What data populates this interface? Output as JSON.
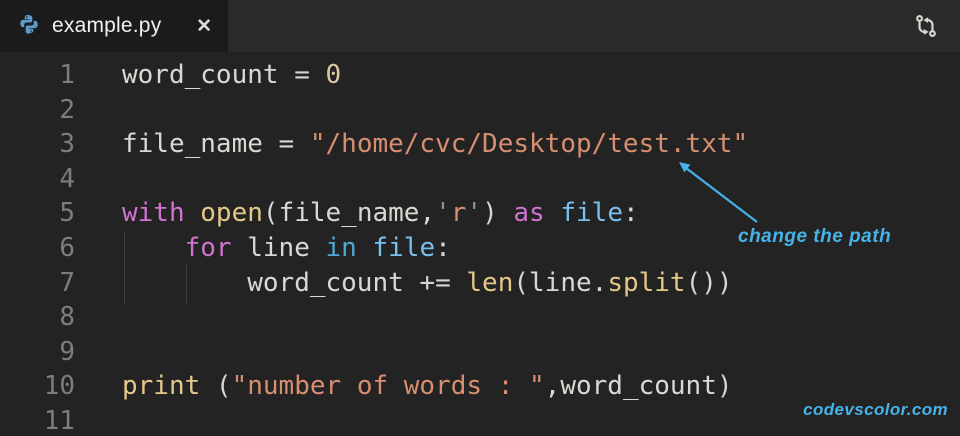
{
  "tab": {
    "title": "example.py",
    "close_glyph": "✕",
    "file_icon": "python-file-icon",
    "action_icon": "sync-arrows-icon"
  },
  "annotation": {
    "text": "change the path"
  },
  "watermark": {
    "text": "codevscolor.com"
  },
  "colors": {
    "editor_bg": "#232323",
    "tabbar_bg": "#2a2a2a",
    "tab_bg": "#1b1b1b",
    "tab_text": "#f0f0f0",
    "line_number": "#7d7d7d",
    "indent_guide": "#3f3f3f",
    "annotation_blue": "#47b2e8",
    "icon_gray": "#d8d8d0",
    "python_icon_blue": "#5a9bc8",
    "syntax": {
      "kw": "#d073cf",
      "fn": "#e4c88a",
      "num": "#dcc9a4",
      "str": "#d78e70",
      "strq": "#909090",
      "var": "#d9d9d4",
      "op": "#d6d6d6",
      "blue": "#79bff0",
      "cyan": "#4fa8d2",
      "plain": "#d9d9d4"
    }
  },
  "editor": {
    "lines": [
      {
        "num": "1",
        "tokens": [
          [
            "var",
            "word_count"
          ],
          [
            "op",
            " = "
          ],
          [
            "num",
            "0"
          ]
        ]
      },
      {
        "num": "2",
        "tokens": []
      },
      {
        "num": "3",
        "tokens": [
          [
            "var",
            "file_name"
          ],
          [
            "op",
            " = "
          ],
          [
            "str",
            "\"/home/cvc/Desktop/test.txt\""
          ]
        ]
      },
      {
        "num": "4",
        "tokens": []
      },
      {
        "num": "5",
        "tokens": [
          [
            "kw",
            "with"
          ],
          [
            "plain",
            " "
          ],
          [
            "fn",
            "open"
          ],
          [
            "op",
            "("
          ],
          [
            "var",
            "file_name"
          ],
          [
            "op",
            ","
          ],
          [
            "strq",
            "'"
          ],
          [
            "str",
            "r"
          ],
          [
            "strq",
            "'"
          ],
          [
            "op",
            ") "
          ],
          [
            "kw",
            "as"
          ],
          [
            "plain",
            " "
          ],
          [
            "blue",
            "file"
          ],
          [
            "op",
            ":"
          ]
        ]
      },
      {
        "num": "6",
        "tokens": [
          [
            "plain",
            "    "
          ],
          [
            "kw",
            "for"
          ],
          [
            "plain",
            " "
          ],
          [
            "var",
            "line"
          ],
          [
            "plain",
            " "
          ],
          [
            "cyan",
            "in"
          ],
          [
            "plain",
            " "
          ],
          [
            "blue",
            "file"
          ],
          [
            "op",
            ":"
          ]
        ]
      },
      {
        "num": "7",
        "tokens": [
          [
            "plain",
            "        "
          ],
          [
            "var",
            "word_count"
          ],
          [
            "op",
            " += "
          ],
          [
            "fn",
            "len"
          ],
          [
            "op",
            "("
          ],
          [
            "var",
            "line"
          ],
          [
            "op",
            "."
          ],
          [
            "fn",
            "split"
          ],
          [
            "op",
            "())"
          ]
        ]
      },
      {
        "num": "8",
        "tokens": []
      },
      {
        "num": "9",
        "tokens": []
      },
      {
        "num": "10",
        "tokens": [
          [
            "fn",
            "print"
          ],
          [
            "op",
            " ("
          ],
          [
            "str",
            "\"number of words : \""
          ],
          [
            "op",
            ","
          ],
          [
            "var",
            "word_count"
          ],
          [
            "op",
            ")"
          ]
        ]
      },
      {
        "num": "11",
        "tokens": []
      }
    ]
  }
}
